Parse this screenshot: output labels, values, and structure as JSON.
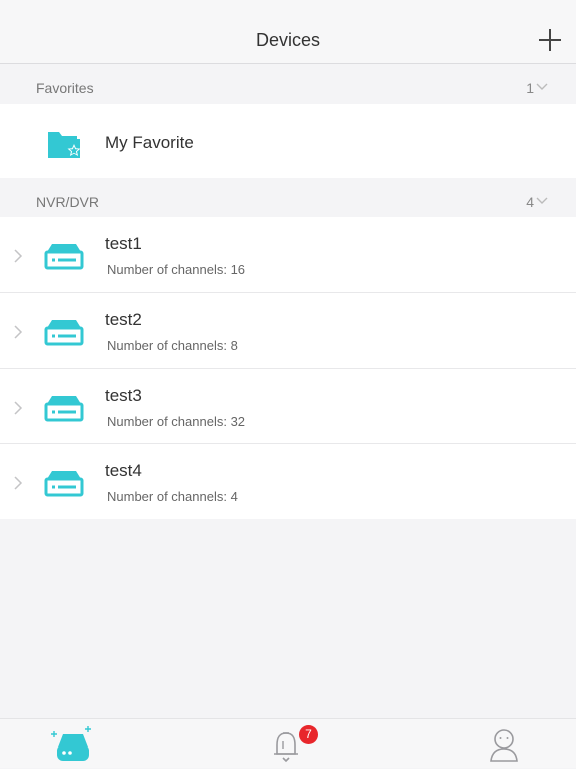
{
  "navbar": {
    "title": "Devices"
  },
  "sections": {
    "favorites": {
      "title": "Favorites",
      "count": "1"
    },
    "nvr": {
      "title": "NVR/DVR",
      "count": "4"
    }
  },
  "favorites": [
    {
      "label": "My Favorite"
    }
  ],
  "devices": [
    {
      "name": "test1",
      "channels": "Number of channels: 16"
    },
    {
      "name": "test2",
      "channels": "Number of channels: 8"
    },
    {
      "name": "test3",
      "channels": "Number of channels: 32"
    },
    {
      "name": "test4",
      "channels": "Number of channels: 4"
    }
  ],
  "tabbar": {
    "badge": "7"
  },
  "colors": {
    "accent": "#33c8d3",
    "badge": "#e8262b",
    "icon_gray": "#9a9a9e"
  }
}
